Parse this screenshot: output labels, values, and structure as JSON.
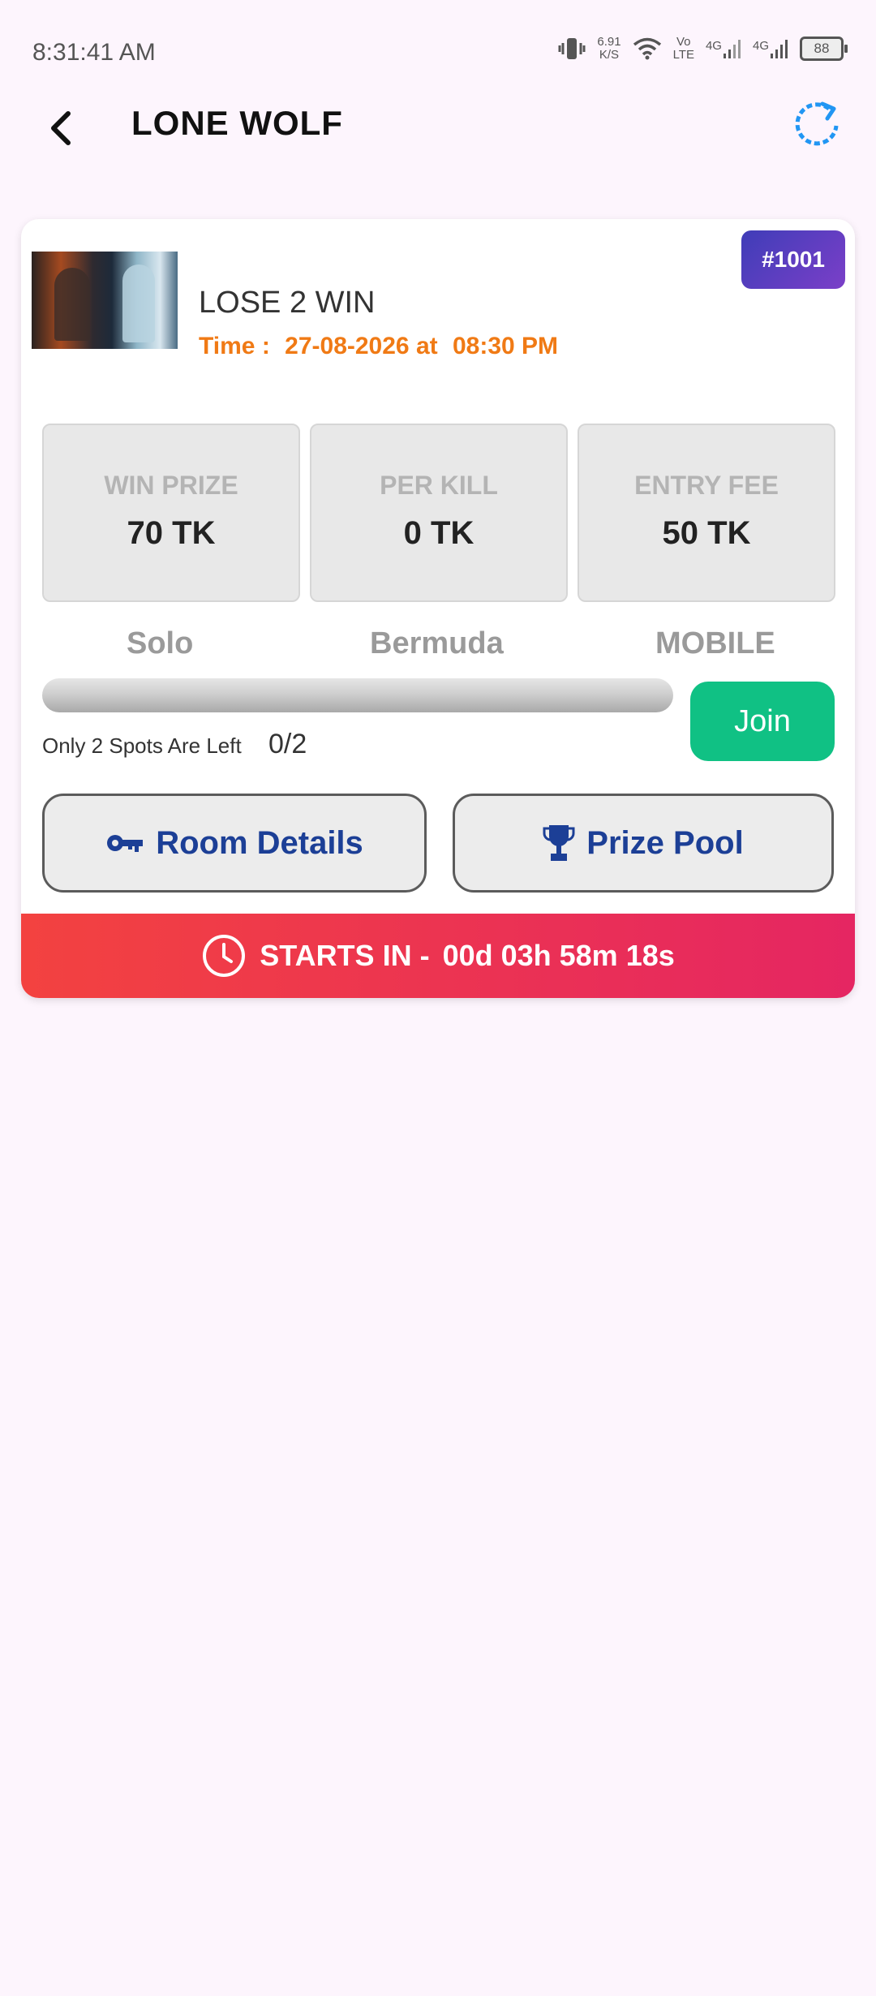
{
  "status_bar": {
    "time": "8:31:41 AM",
    "net_speed_value": "6.91",
    "net_speed_unit": "K/S",
    "volte_top": "Vo",
    "volte_bottom": "LTE",
    "network_1": "4G",
    "network_2": "4G",
    "battery": "88",
    "icons": [
      "vibrate-icon",
      "wifi-icon",
      "signal-icon",
      "battery-icon"
    ]
  },
  "header": {
    "title": "LONE WOLF",
    "back_icon": "chevron-left-icon",
    "refresh_icon": "refresh-icon",
    "refresh_color": "#2196f3"
  },
  "match": {
    "badge": "#1001",
    "title": "LOSE 2 WIN",
    "time_label": "Time :",
    "date": "27-08-2026 at",
    "clock": "08:30 PM",
    "stats": [
      {
        "label": "WIN PRIZE",
        "value": "70 TK"
      },
      {
        "label": "PER KILL",
        "value": "0 TK"
      },
      {
        "label": "ENTRY FEE",
        "value": "50 TK"
      }
    ],
    "mode": "Solo",
    "map": "Bermuda",
    "platform": "MOBILE",
    "progress": 0,
    "spots_left_text": "Only 2 Spots Are Left",
    "spots_count": "0/2",
    "join_label": "Join",
    "join_color": "#10c184",
    "room_details_label": "Room Details",
    "prize_pool_label": "Prize Pool",
    "countdown_label": "STARTS IN -",
    "countdown_value": "00d 03h 58m 18s"
  }
}
